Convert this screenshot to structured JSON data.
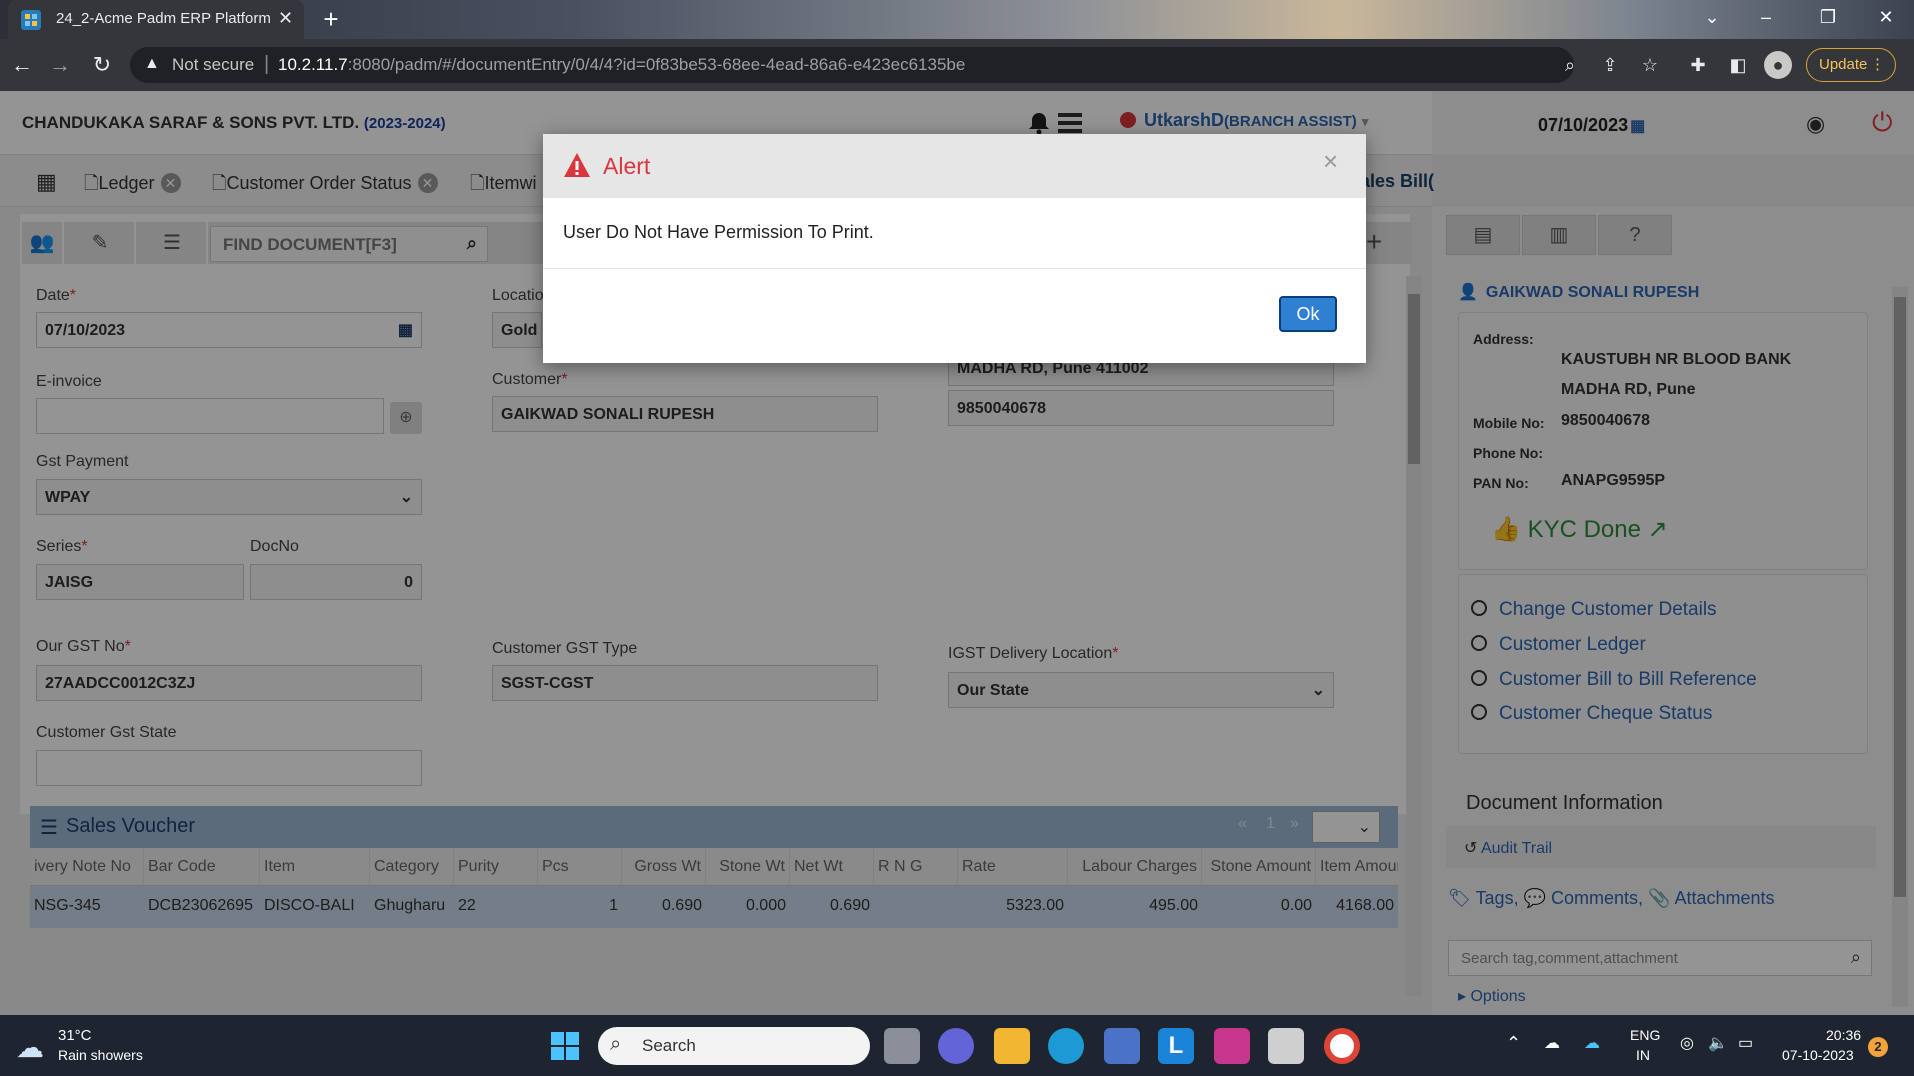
{
  "browser": {
    "tab_title": "24_2-Acme Padm ERP Platform",
    "not_secure": "Not secure",
    "url_host": "10.2.11.7",
    "url_path": ":8080/padm/#/documentEntry/0/4/4?id=0f83be53-68ee-4ead-86a6-e423ec6135be",
    "update_label": "Update"
  },
  "header": {
    "company": "CHANDUKAKA SARAF & SONS PVT. LTD.",
    "year": "(2023-2024)",
    "user": "UtkarshD",
    "role": "(BRANCH ASSIST)",
    "date": "07/10/2023"
  },
  "tabs": [
    {
      "label": "Ledger"
    },
    {
      "label": "Customer Order Status"
    },
    {
      "label": "Itemwi"
    },
    {
      "label": "ales Bill("
    }
  ],
  "toolbar": {
    "find_placeholder": "FIND DOCUMENT[F3]"
  },
  "form": {
    "date_label": "Date",
    "date_value": "07/10/2023",
    "location_label": "Locatio",
    "location_value": "Gold",
    "einvoice_label": "E-invoice",
    "customer_label": "Customer",
    "customer_value": "GAIKWAD SONALI RUPESH",
    "address_line": "MADHA RD, Pune 411002",
    "mobile_value": "9850040678",
    "gst_payment_label": "Gst Payment",
    "gst_payment_value": "WPAY",
    "series_label": "Series",
    "series_value": "JAISG",
    "docno_label": "DocNo",
    "docno_value": "0",
    "our_gst_label": "Our GST No",
    "our_gst_value": "27AADCC0012C3ZJ",
    "cust_gst_type_label": "Customer GST Type",
    "cust_gst_type_value": "SGST-CGST",
    "igst_label": "IGST Delivery Location",
    "igst_value": "Our State",
    "cust_gst_state_label": "Customer Gst State"
  },
  "grid": {
    "title": "Sales Voucher",
    "pager_prev": "«",
    "pager_page": "1",
    "pager_next": "»",
    "columns": [
      "ivery Note No",
      "Bar Code",
      "Item",
      "Category",
      "Purity",
      "Pcs",
      "Gross Wt",
      "Stone Wt",
      "Net Wt",
      "R N G",
      "Rate",
      "Labour Charges",
      "Stone Amount",
      "Item Amount"
    ],
    "row": [
      "NSG-345",
      "DCB23062695",
      "DISCO-BALI",
      "Ghugharu",
      "22",
      "1",
      "0.690",
      "0.000",
      "0.690",
      "",
      "5323.00",
      "495.00",
      "0.00",
      "4168.00"
    ]
  },
  "customer_panel": {
    "name": "GAIKWAD SONALI RUPESH",
    "address_label": "Address:",
    "address_line1": "KAUSTUBH NR BLOOD BANK",
    "address_line2": "MADHA RD, Pune",
    "mobile_label": "Mobile No:",
    "mobile": "9850040678",
    "phone_label": "Phone No:",
    "pan_label": "PAN No:",
    "pan": "ANAPG9595P",
    "kyc": "KYC Done",
    "links": [
      "Change Customer Details",
      "Customer Ledger",
      "Customer Bill to Bill Reference",
      "Customer Cheque Status"
    ]
  },
  "doc_info": {
    "title": "Document Information",
    "audit": "Audit Trail",
    "tags": "Tags,",
    "comments": "Comments,",
    "attachments": "Attachments",
    "search_placeholder": "Search tag,comment,attachment",
    "options": "Options"
  },
  "modal": {
    "title": "Alert",
    "message": "User Do Not Have Permission To Print.",
    "ok": "Ok",
    "close": "×"
  },
  "taskbar": {
    "temp": "31°C",
    "weather": "Rain showers",
    "search": "Search",
    "lang1": "ENG",
    "lang2": "IN",
    "time": "20:36",
    "date": "07-10-2023",
    "badge": "2"
  }
}
